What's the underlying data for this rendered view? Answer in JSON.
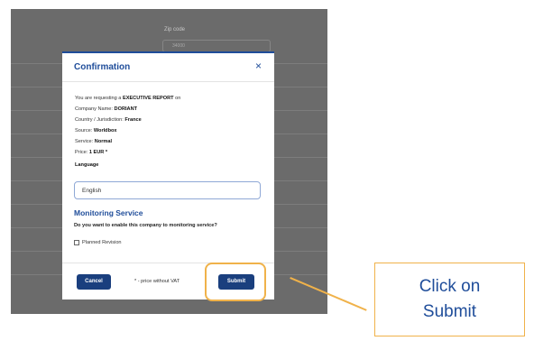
{
  "background_page": {
    "zip_label": "Zip code",
    "zip_value": "34000"
  },
  "modal": {
    "title": "Confirmation",
    "close_symbol": "×",
    "request_prefix": "You are requesting a",
    "report_type": "EXECUTIVE REPORT",
    "request_suffix": "on",
    "company_label": "Company Name:",
    "company_value": "DORIANT",
    "country_label": "Country / Jurisdiction:",
    "country_value": "France",
    "source_label": "Source:",
    "source_value": "Worldbox",
    "service_label": "Service:",
    "service_value": "Normal",
    "price_label": "Price:",
    "price_value": "1 EUR *",
    "language_label": "Language",
    "language_value": "English",
    "monitoring_title": "Monitoring Service",
    "monitoring_question": "Do you want to enable this company to monitoring service?",
    "planned_revision_label": "Planned Revision",
    "planned_revision_checked": false,
    "cancel_label": "Cancel",
    "vat_note": "* - price without VAT",
    "submit_label": "Submit"
  },
  "annotation": {
    "callout_text": "Click on Submit",
    "accent_color": "#f0b24a",
    "text_color": "#1f4d9a"
  },
  "colors": {
    "brand_blue": "#1f4d9a",
    "button_blue": "#1a3f7e",
    "backdrop": "#6b6b6b"
  }
}
